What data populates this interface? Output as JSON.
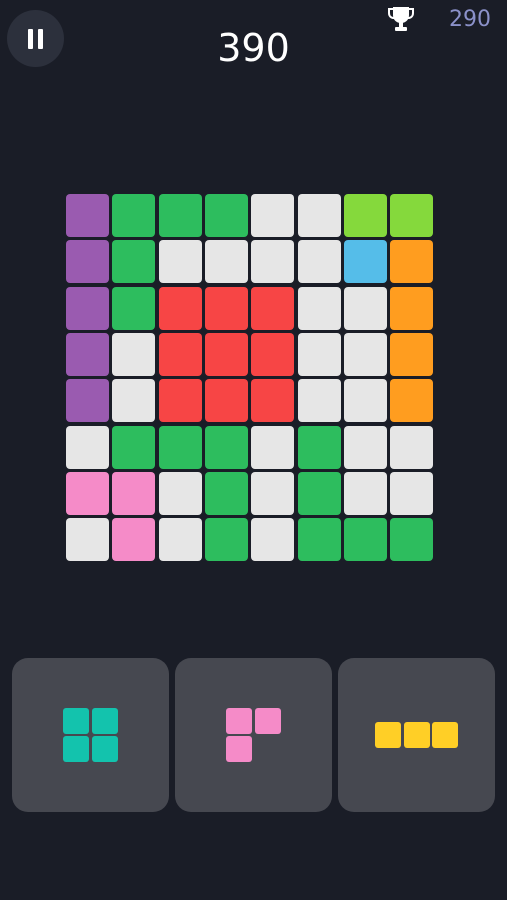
{
  "header": {
    "score": "390",
    "best_score": "290",
    "pause_icon": "pause-icon",
    "trophy_icon": "trophy-icon"
  },
  "colors": {
    "W": "#e6e6e6",
    "G": "#2dbd5e",
    "P": "#9a5bb0",
    "L": "#85d93c",
    "B": "#55bde9",
    "O": "#ff9d1f",
    "R": "#f74545",
    "K": "#f58bc8",
    "teal": "#13c3ad",
    "pink": "#f58bc8",
    "yellow": "#ffcf26"
  },
  "board": {
    "rows": 8,
    "cols": 8,
    "cells": [
      [
        "P",
        "G",
        "G",
        "G",
        "W",
        "W",
        "L",
        "L"
      ],
      [
        "P",
        "G",
        "W",
        "W",
        "W",
        "W",
        "B",
        "O"
      ],
      [
        "P",
        "G",
        "R",
        "R",
        "R",
        "W",
        "W",
        "O"
      ],
      [
        "P",
        "W",
        "R",
        "R",
        "R",
        "W",
        "W",
        "O"
      ],
      [
        "P",
        "W",
        "R",
        "R",
        "R",
        "W",
        "W",
        "O"
      ],
      [
        "W",
        "G",
        "G",
        "G",
        "W",
        "G",
        "W",
        "W"
      ],
      [
        "K",
        "K",
        "W",
        "G",
        "W",
        "G",
        "W",
        "W"
      ],
      [
        "W",
        "K",
        "W",
        "G",
        "W",
        "G",
        "G",
        "G"
      ]
    ]
  },
  "tray": {
    "pieces": [
      {
        "name": "square-2x2",
        "color": "teal",
        "shape": [
          [
            1,
            1
          ],
          [
            1,
            1
          ]
        ]
      },
      {
        "name": "corner-3",
        "color": "pink",
        "shape": [
          [
            1,
            1
          ],
          [
            1,
            0
          ]
        ]
      },
      {
        "name": "line-3",
        "color": "yellow",
        "shape": [
          [
            1,
            1,
            1
          ]
        ]
      }
    ]
  }
}
